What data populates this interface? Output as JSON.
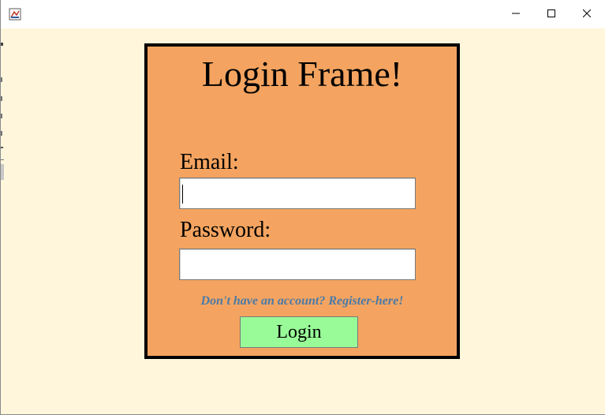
{
  "window": {
    "title": "",
    "controls": {
      "minimize_icon": "minimize-icon",
      "maximize_icon": "maximize-icon",
      "close_icon": "close-icon"
    }
  },
  "login": {
    "heading": "Login Frame!",
    "email_label": "Email:",
    "email_value": "",
    "password_label": "Password:",
    "password_value": "",
    "register_link": "Don't have an account? Register-here!",
    "login_button": "Login"
  },
  "colors": {
    "window_background": "#fff6dc",
    "panel_background": "#f4a460",
    "panel_border": "#000000",
    "link_color": "#4a7aa8",
    "button_background": "#98fb98"
  }
}
